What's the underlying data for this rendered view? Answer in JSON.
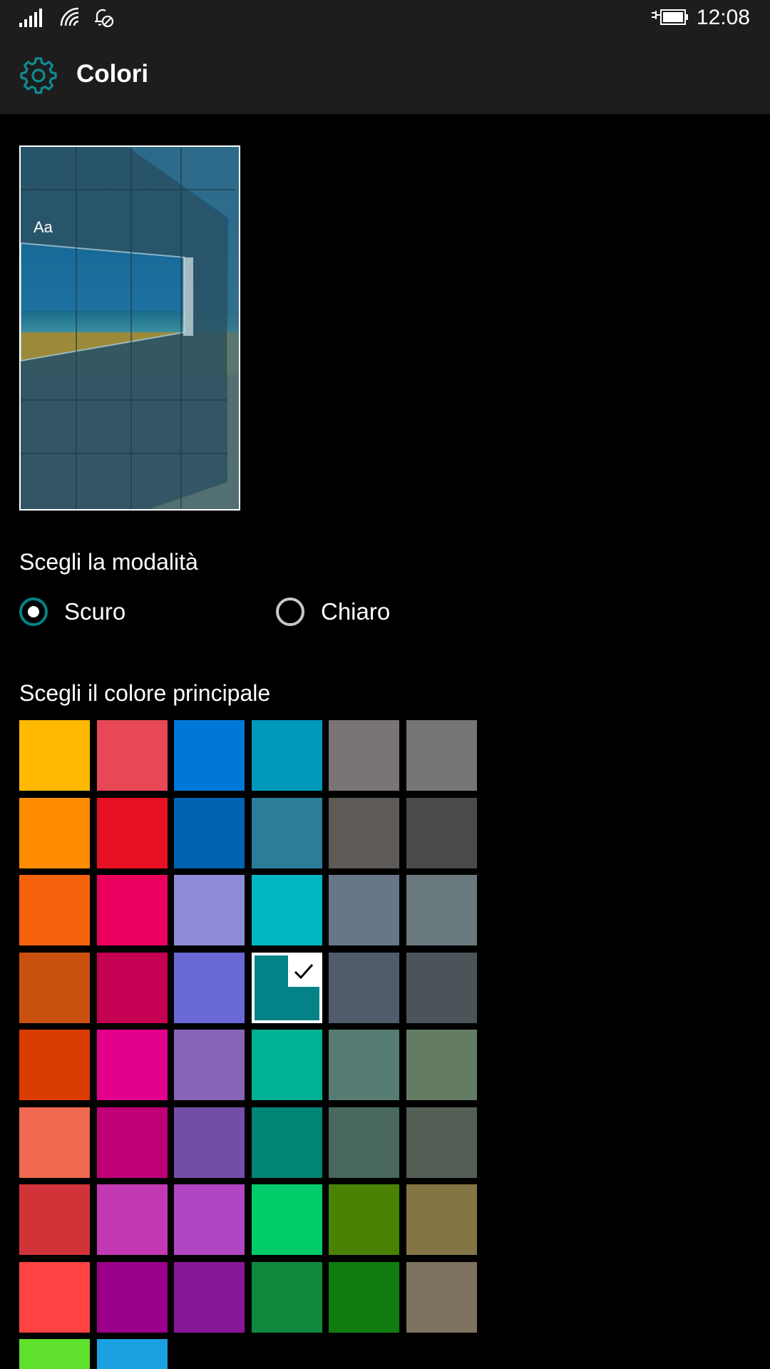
{
  "status_bar": {
    "time": "12:08",
    "icons": [
      "signal-icon",
      "wifi-icon",
      "quiet-hours-icon",
      "battery-charging-icon"
    ]
  },
  "header": {
    "icon": "gear-icon",
    "title": "Colori"
  },
  "preview": {
    "sample_text": "Aa"
  },
  "mode": {
    "label": "Scegli la modalità",
    "options": [
      {
        "label": "Scuro",
        "selected": true
      },
      {
        "label": "Chiaro",
        "selected": false
      }
    ]
  },
  "accent": {
    "label": "Scegli il colore principale",
    "selected_color": "#038387",
    "colors": [
      [
        "#FFB900",
        "#E74856",
        "#0078D7",
        "#0099BC",
        "#7A7574",
        "#767676"
      ],
      [
        "#FF8C00",
        "#E81123",
        "#0063B1",
        "#2D7D9A",
        "#5D5A58",
        "#4C4A48"
      ],
      [
        "#F7630C",
        "#EA005E",
        "#8E8CD8",
        "#00B7C3",
        "#68768A",
        "#69797E"
      ],
      [
        "#CA5010",
        "#C30052",
        "#6B69D6",
        "#038387",
        "#515C6B",
        "#4A5459"
      ],
      [
        "#DA3B01",
        "#E3008C",
        "#8764B8",
        "#00B294",
        "#567C73",
        "#647C64"
      ],
      [
        "#EF6950",
        "#BF0077",
        "#744DA9",
        "#018574",
        "#486860",
        "#525E54"
      ],
      [
        "#D13438",
        "#C239B3",
        "#B146C2",
        "#00CC6A",
        "#498205",
        "#847545"
      ],
      [
        "#FF4343",
        "#9A0089",
        "#881798",
        "#10893E",
        "#107C10",
        "#7E735F"
      ],
      [
        "#5FE12D",
        "#1BA1E2"
      ]
    ]
  }
}
